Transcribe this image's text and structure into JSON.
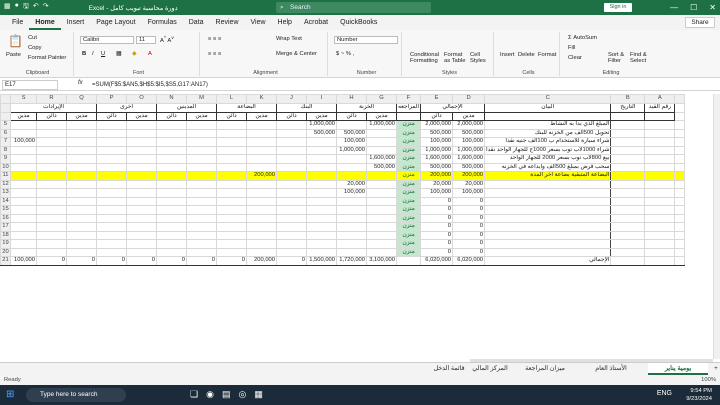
{
  "window": {
    "title": "Excel - دورة محاسبة تبويب كامل",
    "search_placeholder": "Search",
    "signin": "Sign in",
    "controls": [
      "—",
      "☐",
      "✕"
    ]
  },
  "tabs": [
    "File",
    "Home",
    "Insert",
    "Page Layout",
    "Formulas",
    "Data",
    "Review",
    "View",
    "Help",
    "Acrobat",
    "QuickBooks"
  ],
  "active_tab": "Home",
  "share_label": "Share",
  "ribbon": {
    "clipboard": {
      "paste": "Paste",
      "cut": "Cut",
      "copy": "Copy",
      "format_painter": "Format Painter",
      "label": "Clipboard"
    },
    "font": {
      "name": "Calibri",
      "size": "11",
      "label": "Font"
    },
    "alignment": {
      "wrap": "Wrap Text",
      "merge": "Merge & Center",
      "label": "Alignment"
    },
    "number": {
      "format": "Number",
      "label": "Number"
    },
    "styles": {
      "conditional": "Conditional Formatting",
      "format_table": "Format as Table",
      "cell_styles": "Cell Styles",
      "label": "Styles"
    },
    "cells": {
      "insert": "Insert",
      "delete": "Delete",
      "format": "Format",
      "label": "Cells"
    },
    "editing": {
      "autosum": "AutoSum",
      "fill": "Fill",
      "clear": "Clear",
      "sort": "Sort & Filter",
      "find": "Find & Select",
      "label": "Editing"
    }
  },
  "formula_bar": {
    "name_box": "E17",
    "fx": "fx",
    "formula": "=SUM(F$5:$AN5,$H$5:$I5,$S5,G17:AN17)"
  },
  "columns": [
    "S",
    "R",
    "Q",
    "P",
    "O",
    "N",
    "M",
    "L",
    "K",
    "J",
    "I",
    "H",
    "G",
    "F",
    "E",
    "D",
    "C",
    "B",
    "A"
  ],
  "header1": {
    "revenues": "الإيرادات",
    "other": "أخرى",
    "debtors": "المدينين",
    "current_assets": "الاصول المتداولة",
    "goods": "البضاعة",
    "bank": "البنك",
    "cash": "الخزنة",
    "review": "المراجعه",
    "total": "الإجمالي",
    "statement": "البيان",
    "date": "التاريخ",
    "entry_no": "رقم القيد"
  },
  "header2": {
    "creditor": "دائن",
    "debtor": "مدين"
  },
  "rows": [
    {
      "n": "5",
      "S": "",
      "R": "",
      "Q": "",
      "P": "",
      "O": "",
      "N": "",
      "M": "",
      "L": "",
      "K": "",
      "J": "",
      "I": "1,000,000",
      "H": "",
      "G": "1,000,000",
      "F": "متزن",
      "E": "2,000,000",
      "D": "2,000,000",
      "C": "المبلغ الذي بدأ به النشاط"
    },
    {
      "n": "6",
      "S": "",
      "R": "",
      "Q": "",
      "P": "",
      "O": "",
      "N": "",
      "M": "",
      "L": "",
      "K": "",
      "J": "",
      "I": "500,000",
      "H": "500,000",
      "G": "",
      "F": "متزن",
      "E": "500,000",
      "D": "500,000",
      "C": "تحويل 500الف من الخزنه للبنك"
    },
    {
      "n": "7",
      "S": "100,000",
      "R": "",
      "Q": "",
      "P": "",
      "O": "",
      "N": "",
      "M": "",
      "L": "",
      "K": "",
      "J": "",
      "I": "",
      "H": "100,000",
      "G": "",
      "F": "متزن",
      "E": "100,000",
      "D": "100,000",
      "C": "شراء سيارة للاستخدام ب 100الف جنيه نقدا"
    },
    {
      "n": "8",
      "S": "",
      "R": "",
      "Q": "",
      "P": "",
      "O": "",
      "N": "",
      "M": "",
      "L": "",
      "K": "",
      "J": "",
      "I": "",
      "H": "1,000,000",
      "G": "",
      "F": "متزن",
      "E": "1,000,000",
      "D": "1,000,000",
      "C": "شراء 1000لاب توب بسعر 1000ج للجهاز الواحد نقدا"
    },
    {
      "n": "9",
      "S": "",
      "R": "",
      "Q": "",
      "P": "",
      "O": "",
      "N": "",
      "M": "",
      "L": "",
      "K": "",
      "J": "",
      "I": "",
      "H": "",
      "G": "1,600,000",
      "F": "متزن",
      "E": "1,600,000",
      "D": "1,600,000",
      "C": "بيع 800لاب توب بسعر 2000 للجهاز الواحد"
    },
    {
      "n": "10",
      "S": "",
      "R": "",
      "Q": "",
      "P": "",
      "O": "",
      "N": "",
      "M": "",
      "L": "",
      "K": "",
      "J": "",
      "I": "",
      "H": "",
      "G": "500,000",
      "F": "متزن",
      "E": "500,000",
      "D": "500,000",
      "C": "سحب قرض بمبلغ 500الف وايداعه في الخزنه"
    },
    {
      "n": "11",
      "S": "",
      "R": "",
      "Q": "",
      "P": "",
      "O": "",
      "N": "",
      "M": "",
      "L": "",
      "K": "200,000",
      "J": "",
      "I": "",
      "H": "",
      "G": "",
      "F": "متزن",
      "E": "200,000",
      "D": "200,000",
      "C": "البضاعة المتبقية بضاعة اخر المدة",
      "yellow": true
    },
    {
      "n": "12",
      "S": "",
      "R": "",
      "Q": "",
      "P": "",
      "O": "",
      "N": "",
      "M": "",
      "L": "",
      "K": "",
      "J": "",
      "I": "",
      "H": "20,000",
      "G": "",
      "F": "متزن",
      "E": "20,000",
      "D": "20,000",
      "C": ""
    },
    {
      "n": "13",
      "S": "",
      "R": "",
      "Q": "",
      "P": "",
      "O": "",
      "N": "",
      "M": "",
      "L": "",
      "K": "",
      "J": "",
      "I": "",
      "H": "100,000",
      "G": "",
      "F": "متزن",
      "E": "100,000",
      "D": "100,000",
      "C": ""
    },
    {
      "n": "14",
      "S": "",
      "R": "",
      "Q": "",
      "P": "",
      "O": "",
      "N": "",
      "M": "",
      "L": "",
      "K": "",
      "J": "",
      "I": "",
      "H": "",
      "G": "",
      "F": "متزن",
      "E": "0",
      "D": "0",
      "C": ""
    },
    {
      "n": "15",
      "S": "",
      "R": "",
      "Q": "",
      "P": "",
      "O": "",
      "N": "",
      "M": "",
      "L": "",
      "K": "",
      "J": "",
      "I": "",
      "H": "",
      "G": "",
      "F": "متزن",
      "E": "0",
      "D": "0",
      "C": ""
    },
    {
      "n": "16",
      "S": "",
      "R": "",
      "Q": "",
      "P": "",
      "O": "",
      "N": "",
      "M": "",
      "L": "",
      "K": "",
      "J": "",
      "I": "",
      "H": "",
      "G": "",
      "F": "متزن",
      "E": "0",
      "D": "0",
      "C": ""
    },
    {
      "n": "17",
      "S": "",
      "R": "",
      "Q": "",
      "P": "",
      "O": "",
      "N": "",
      "M": "",
      "L": "",
      "K": "",
      "J": "",
      "I": "",
      "H": "",
      "G": "",
      "F": "متزن",
      "E": "0",
      "D": "0",
      "C": ""
    },
    {
      "n": "18",
      "S": "",
      "R": "",
      "Q": "",
      "P": "",
      "O": "",
      "N": "",
      "M": "",
      "L": "",
      "K": "",
      "J": "",
      "I": "",
      "H": "",
      "G": "",
      "F": "متزن",
      "E": "0",
      "D": "0",
      "C": ""
    },
    {
      "n": "19",
      "S": "",
      "R": "",
      "Q": "",
      "P": "",
      "O": "",
      "N": "",
      "M": "",
      "L": "",
      "K": "",
      "J": "",
      "I": "",
      "H": "",
      "G": "",
      "F": "متزن",
      "E": "0",
      "D": "0",
      "C": ""
    },
    {
      "n": "20",
      "S": "",
      "R": "",
      "Q": "",
      "P": "",
      "O": "",
      "N": "",
      "M": "",
      "L": "",
      "K": "",
      "J": "",
      "I": "",
      "H": "",
      "G": "",
      "F": "متزن",
      "E": "0",
      "D": "0",
      "C": ""
    }
  ],
  "total_row": {
    "n": "21",
    "S": "100,000",
    "R": "0",
    "Q": "0",
    "P": "0",
    "O": "0",
    "N": "0",
    "M": "0",
    "L": "0",
    "K": "200,000",
    "J": "0",
    "I": "1,500,000",
    "H": "1,720,000",
    "G": "3,100,000",
    "F": "",
    "E": "6,020,000",
    "D": "6,020,000",
    "C": "الإجمالي"
  },
  "sheet_tabs": [
    "يومية يناير",
    "الأستاذ العام",
    "ميزان المراجعة",
    "المركز المالي",
    "قائمة الدخل"
  ],
  "active_sheet": "يومية يناير",
  "status": {
    "ready": "Ready",
    "zoom": "100%"
  },
  "taskbar": {
    "search": "Type here to search",
    "time": "9:54 PM",
    "date": "9/23/2024",
    "lang": "ENG"
  }
}
